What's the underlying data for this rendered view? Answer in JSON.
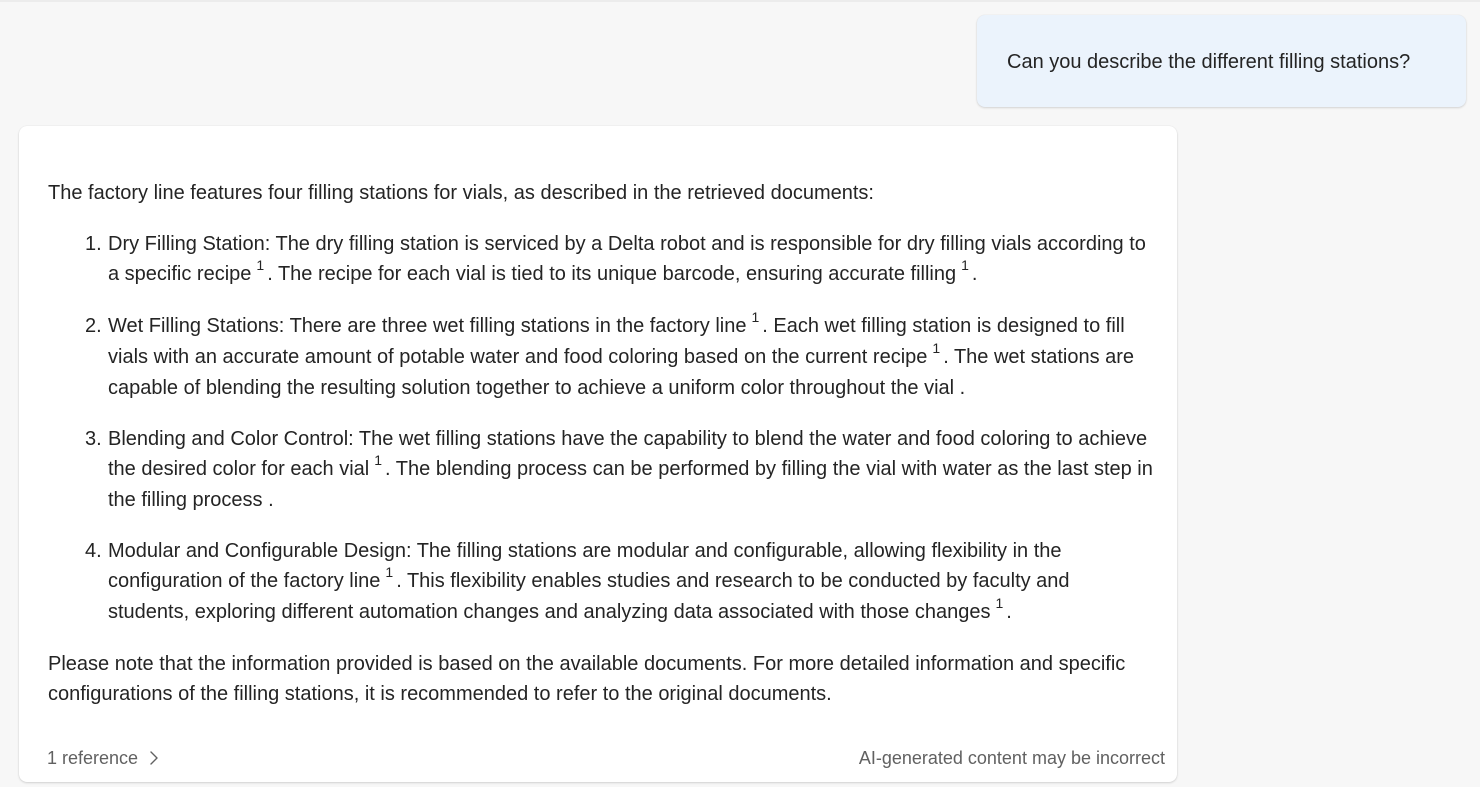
{
  "user_message": "Can you describe the different filling stations?",
  "answer": {
    "intro": "The factory line features four filling stations for vials, as described in the retrieved documents:",
    "items": [
      {
        "number": "1.",
        "segments": [
          {
            "text": "Dry Filling Station: The dry filling station is serviced by a Delta robot and is responsible for dry filling vials according to a specific recipe"
          },
          {
            "cite": "1"
          },
          {
            "text": ". The recipe for each vial is tied to its unique barcode, ensuring accurate filling"
          },
          {
            "cite": "1"
          },
          {
            "text": "."
          }
        ]
      },
      {
        "number": "2.",
        "segments": [
          {
            "text": "Wet Filling Stations: There are three wet filling stations in the factory line"
          },
          {
            "cite": "1"
          },
          {
            "text": ". Each wet filling station is designed to fill vials with an accurate amount of potable water and food coloring based on the current recipe"
          },
          {
            "cite": "1"
          },
          {
            "text": ". The wet stations are capable of blending the resulting solution together to achieve a uniform color throughout the vial ."
          }
        ]
      },
      {
        "number": "3.",
        "segments": [
          {
            "text": "Blending and Color Control: The wet filling stations have the capability to blend the water and food coloring to achieve the desired color for each vial"
          },
          {
            "cite": "1"
          },
          {
            "text": ". The blending process can be performed by filling the vial with water as the last step in the filling process ."
          }
        ]
      },
      {
        "number": "4.",
        "segments": [
          {
            "text": "Modular and Configurable Design: The filling stations are modular and configurable, allowing flexibility in the configuration of the factory line"
          },
          {
            "cite": "1"
          },
          {
            "text": ". This flexibility enables studies and research to be conducted by faculty and students, exploring different automation changes and analyzing data associated with those changes"
          },
          {
            "cite": "1"
          },
          {
            "text": "."
          }
        ]
      }
    ],
    "closing": "Please note that the information provided is based on the available documents. For more detailed information and specific configurations of the filling stations, it is recommended to refer to the original documents."
  },
  "footer": {
    "references_label": "1 reference",
    "chevron_icon": "chevron-right-icon",
    "disclaimer": "AI-generated content may be incorrect"
  },
  "colors": {
    "page_background": "#f7f7f7",
    "user_bubble": "#ebf3fc",
    "card_background": "#ffffff",
    "text": "#242424",
    "muted_text": "#616161"
  }
}
